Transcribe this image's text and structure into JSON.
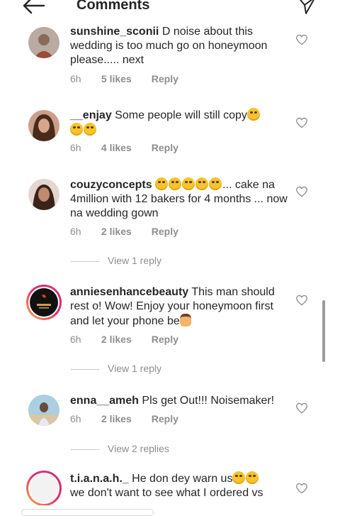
{
  "header": {
    "title": "Comments",
    "back_icon": "arrow-left-icon",
    "send_icon": "paper-plane-icon"
  },
  "comments": [
    {
      "username": "sunshine_sconii",
      "text": "D noise about this wedding is too much go on honeymoon please..... next",
      "time": "6h",
      "likes": "5 likes",
      "reply": "Reply",
      "avatar_color": "#8a6a5a"
    },
    {
      "username": "__enjay",
      "text": "Some people will still copy",
      "time": "6h",
      "likes": "4 likes",
      "reply": "Reply",
      "avatar_color": "#6b4a3a"
    },
    {
      "username": "couzyconcepts",
      "text_after": "... cake na 4million with 12 bakers for 4 months ... now na wedding gown",
      "time": "6h",
      "likes": "2 likes",
      "reply": "Reply",
      "avatar_color": "#9b7a6a"
    },
    {
      "username": "anniesenhancebeauty",
      "text": "This man should rest o! Wow! Enjoy your honeymoon first and let your phone be",
      "time": "6h",
      "likes": "2 likes",
      "reply": "Reply",
      "avatar_color": "#1a1a1a"
    },
    {
      "username": "enna__ameh",
      "text": "Pls get Out!!! Noisemaker!",
      "time": "6h",
      "likes": "2 likes",
      "reply": "Reply",
      "avatar_color": "#7fb0c8"
    },
    {
      "username": "t.i.a.n.a.h._",
      "text": "He don dey warn us",
      "text_line2": "we don't want to see what I ordered vs",
      "avatar_color": "#f0f0f0"
    }
  ],
  "view_replies": [
    "View 1 reply",
    "View 1 reply",
    "View 2 replies"
  ],
  "colors": {
    "text": "#262626",
    "secondary": "#8e8e8e",
    "story_ring_start": "#c13584",
    "story_ring_end": "#fcaf45"
  }
}
